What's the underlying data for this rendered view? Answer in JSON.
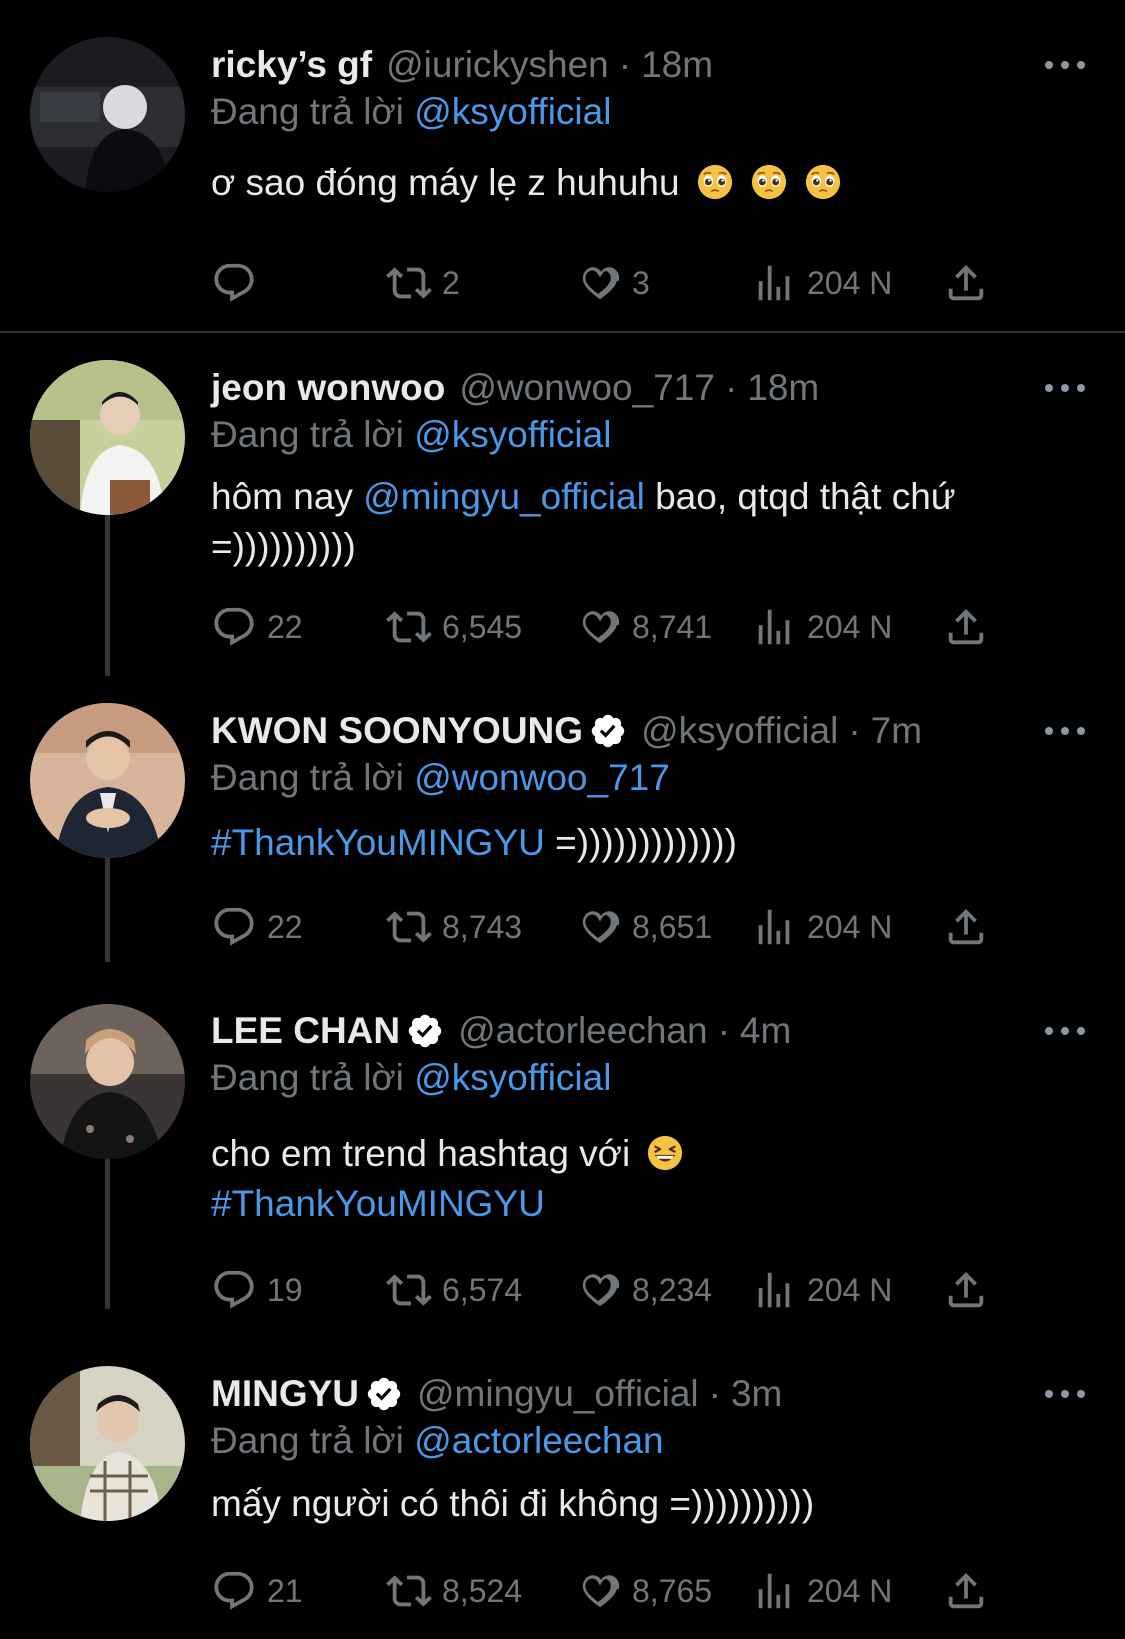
{
  "reply_prefix": "Đang trả lời",
  "tweets": [
    {
      "name": "ricky’s gf",
      "handle": "@iurickyshen",
      "time": "18m",
      "reply_to": "@ksyofficial",
      "text_a": "ơ sao đóng máy lẹ z huhuhu",
      "replies": "",
      "retweets": "2",
      "likes": "3",
      "views": "204 N",
      "verified": false
    },
    {
      "name": "jeon wonwoo",
      "handle": "@wonwoo_717",
      "time": "18m",
      "reply_to": "@ksyofficial",
      "text_a": "hôm nay",
      "mention": "@mingyu_official",
      "text_b": "bao, qtqd thật chứ",
      "text_c": "=))))))))))",
      "replies": "22",
      "retweets": "6,545",
      "likes": "8,741",
      "views": "204 N",
      "verified": false
    },
    {
      "name": "KWON SOONYOUNG",
      "handle": "@ksyofficial",
      "time": "7m",
      "reply_to": "@wonwoo_717",
      "hashtag": "#ThankYouMINGYU",
      "text_b": "=)))))))))))))",
      "replies": "22",
      "retweets": "8,743",
      "likes": "8,651",
      "views": "204 N",
      "verified": true
    },
    {
      "name": "LEE CHAN",
      "handle": "@actorleechan",
      "time": "4m",
      "reply_to": "@ksyofficial",
      "text_a": "cho em trend hashtag với",
      "hashtag": "#ThankYouMINGYU",
      "replies": "19",
      "retweets": "6,574",
      "likes": "8,234",
      "views": "204 N",
      "verified": true
    },
    {
      "name": "MINGYU",
      "handle": "@mingyu_official",
      "time": "3m",
      "reply_to": "@actorleechan",
      "text_a": "mấy người có thôi đi không =))))))))))",
      "replies": "21",
      "retweets": "8,524",
      "likes": "8,765",
      "views": "204 N",
      "verified": true
    }
  ],
  "colors": {
    "background": "#000000",
    "link": "#4a99e9",
    "muted": "#71767b",
    "verified": "#ffffff"
  },
  "icons": [
    "reply-icon",
    "retweet-icon",
    "like-icon",
    "views-icon",
    "share-icon",
    "more-icon",
    "verified-badge-icon",
    "pleading-face-emoji",
    "grinning-squinting-emoji"
  ]
}
